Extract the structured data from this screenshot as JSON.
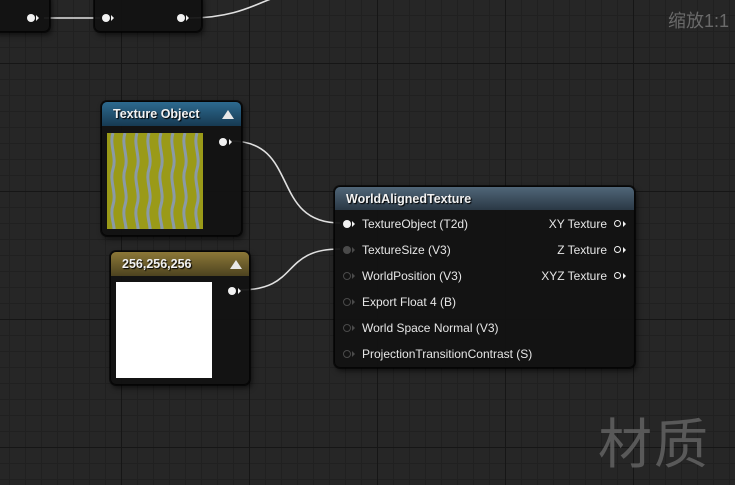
{
  "zoom_label": "缩放1:1",
  "watermark": "材质",
  "texture_object_node": {
    "title": "Texture Object"
  },
  "constant_node": {
    "title": "256,256,256",
    "preview_color": "#ffffff"
  },
  "world_aligned_node": {
    "title": "WorldAlignedTexture",
    "inputs": [
      "TextureObject (T2d)",
      "TextureSize (V3)",
      "WorldPosition (V3)",
      "Export Float 4 (B)",
      "World Space Normal (V3)",
      "ProjectionTransitionContrast (S)"
    ],
    "outputs": [
      "XY Texture",
      "Z Texture",
      "XYZ Texture"
    ]
  },
  "colors": {
    "canvas_bg": "#262626",
    "texture_header": "#1f4e6e",
    "constant_header": "#6b5a2a",
    "world_header": "#3a4c5c",
    "wire": "#e6e6e6"
  }
}
